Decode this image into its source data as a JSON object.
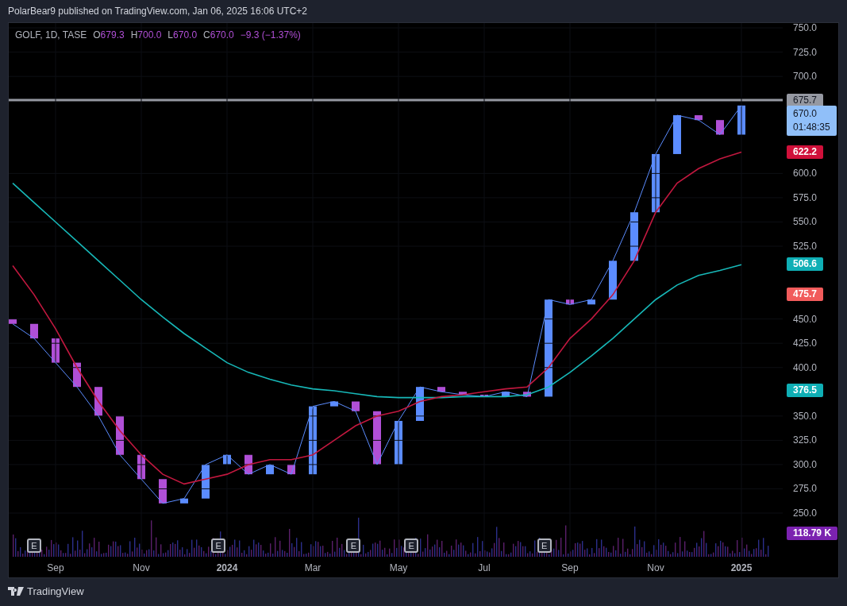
{
  "header": {
    "text": "PolarBear9 published on TradingView.com, Jan 06, 2025 16:06 UTC+2"
  },
  "legend": {
    "symbol": "GOLF, 1D, TASE",
    "ohlc": [
      {
        "key": "O",
        "value": "679.3"
      },
      {
        "key": "H",
        "value": "700.0"
      },
      {
        "key": "L",
        "value": "670.0"
      },
      {
        "key": "C",
        "value": "670.0"
      }
    ],
    "change": "−9.3 (−1.37%)"
  },
  "chart": {
    "chart_data": {
      "type": "line",
      "categories": [
        null,
        null,
        "Sep",
        null,
        null,
        null,
        "Nov",
        null,
        null,
        null,
        "2024",
        null,
        null,
        null,
        "Mar",
        null,
        null,
        null,
        "May",
        null,
        null,
        null,
        "Jul",
        null,
        null,
        null,
        "Sep",
        null,
        null,
        null,
        "Nov",
        null,
        null,
        null,
        "2025"
      ],
      "ylim": [
        205,
        755
      ],
      "grid": true,
      "yticks": [
        {
          "value": 750,
          "label": "750.0"
        },
        {
          "value": 725,
          "label": "725.0"
        },
        {
          "value": 700,
          "label": "700.0"
        },
        {
          "value": 600,
          "label": "600.0"
        },
        {
          "value": 575,
          "label": "575.0"
        },
        {
          "value": 550,
          "label": "550.0"
        },
        {
          "value": 525,
          "label": "525.0"
        },
        {
          "value": 450,
          "label": "450.0"
        },
        {
          "value": 425,
          "label": "425.0"
        },
        {
          "value": 400,
          "label": "400.0"
        },
        {
          "value": 350,
          "label": "350.0"
        },
        {
          "value": 325,
          "label": "325.0"
        },
        {
          "value": 300,
          "label": "300.0"
        },
        {
          "value": 275,
          "label": "275.0"
        },
        {
          "value": 250,
          "label": "250.0"
        }
      ],
      "series": [
        {
          "color": "#5b8cff",
          "values": [
            445,
            430,
            405,
            380,
            350,
            310,
            285,
            260,
            265,
            300,
            310,
            290,
            300,
            290,
            360,
            365,
            355,
            300,
            345,
            380,
            375,
            372,
            370,
            375,
            370,
            470,
            465,
            470,
            510,
            560,
            620,
            660,
            655,
            640,
            670
          ]
        },
        {
          "color": "#17b8b8",
          "values": [
            590,
            570,
            550,
            530,
            510,
            490,
            470,
            452,
            435,
            420,
            405,
            395,
            388,
            382,
            378,
            376,
            373,
            370,
            369,
            369,
            369,
            370,
            370,
            370,
            372,
            380,
            395,
            412,
            430,
            450,
            470,
            485,
            495,
            500,
            506
          ]
        },
        {
          "color": "#c2183f",
          "values": [
            505,
            475,
            440,
            400,
            365,
            335,
            310,
            290,
            280,
            285,
            290,
            300,
            305,
            305,
            310,
            325,
            340,
            350,
            355,
            365,
            370,
            372,
            375,
            378,
            380,
            400,
            430,
            450,
            475,
            510,
            560,
            590,
            605,
            615,
            622
          ]
        }
      ]
    }
  },
  "earnings_markers": [
    {
      "text": "E"
    },
    {
      "text": "E"
    },
    {
      "text": "E"
    },
    {
      "text": "E"
    },
    {
      "text": "E"
    }
  ],
  "price_labels": [
    {
      "kind": "line",
      "text": "675.7",
      "color": "#9598a1"
    },
    {
      "kind": "last",
      "text": "670.0",
      "timer": "01:48:35",
      "color": "#90bff9"
    },
    {
      "kind": "ma",
      "text": "622.2",
      "color": "#d0103a"
    },
    {
      "kind": "ma",
      "text": "506.6",
      "color": "#0fafb5"
    },
    {
      "kind": "ma",
      "text": "475.7",
      "color": "#f15b5b"
    },
    {
      "kind": "ma",
      "text": "376.5",
      "color": "#0fafb5"
    },
    {
      "kind": "volume",
      "text": "118.79 K",
      "color": "#7b22b0"
    }
  ],
  "footer": {
    "brand": "TradingView"
  }
}
